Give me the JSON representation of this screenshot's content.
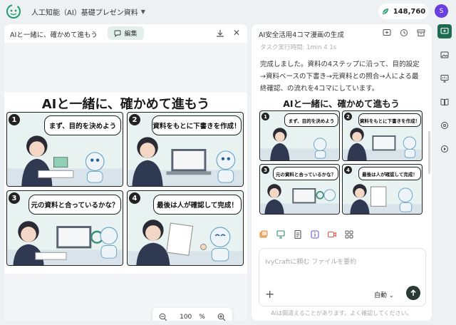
{
  "app": {
    "doc_title": "人工知能（AI）基礎プレゼン資料",
    "credits": "148,760",
    "avatar_initial": "S",
    "accent": "#1e6b52"
  },
  "left_panel": {
    "title": "AIと一緒に、確かめて進もう",
    "edit_label": "編集",
    "zoom_value": "100",
    "zoom_unit": "%"
  },
  "manga": {
    "title": "AIと一緒に、確かめて進もう",
    "panels": [
      {
        "num": "1",
        "text": "まず、目的を決めよう"
      },
      {
        "num": "2",
        "text": "資料をもとに下書きを作成！"
      },
      {
        "num": "3",
        "text": "元の資料と合っているかな？"
      },
      {
        "num": "4",
        "text": "最後は人が確認して完成！"
      }
    ]
  },
  "right_panel": {
    "title": "AI安全活用4コマ漫画の生成",
    "faded_text": "タスク実行時間: 1min 4 1s",
    "message": "完成しました。資料の4ステップに沿って、目的設定→資料ベースの下書き→元資料との照合→人による最終確認、の流れを4コマにしています。",
    "input_placeholder": "IvyCraftに頼む ファイルを要約",
    "model_label": "自動",
    "disclaimer": "AIは間違えることがあります。よく確認してください。"
  },
  "sidebar": {
    "items": [
      "chat-icon",
      "image-icon",
      "slides-icon",
      "book-icon",
      "compass-icon",
      "video-icon"
    ]
  }
}
